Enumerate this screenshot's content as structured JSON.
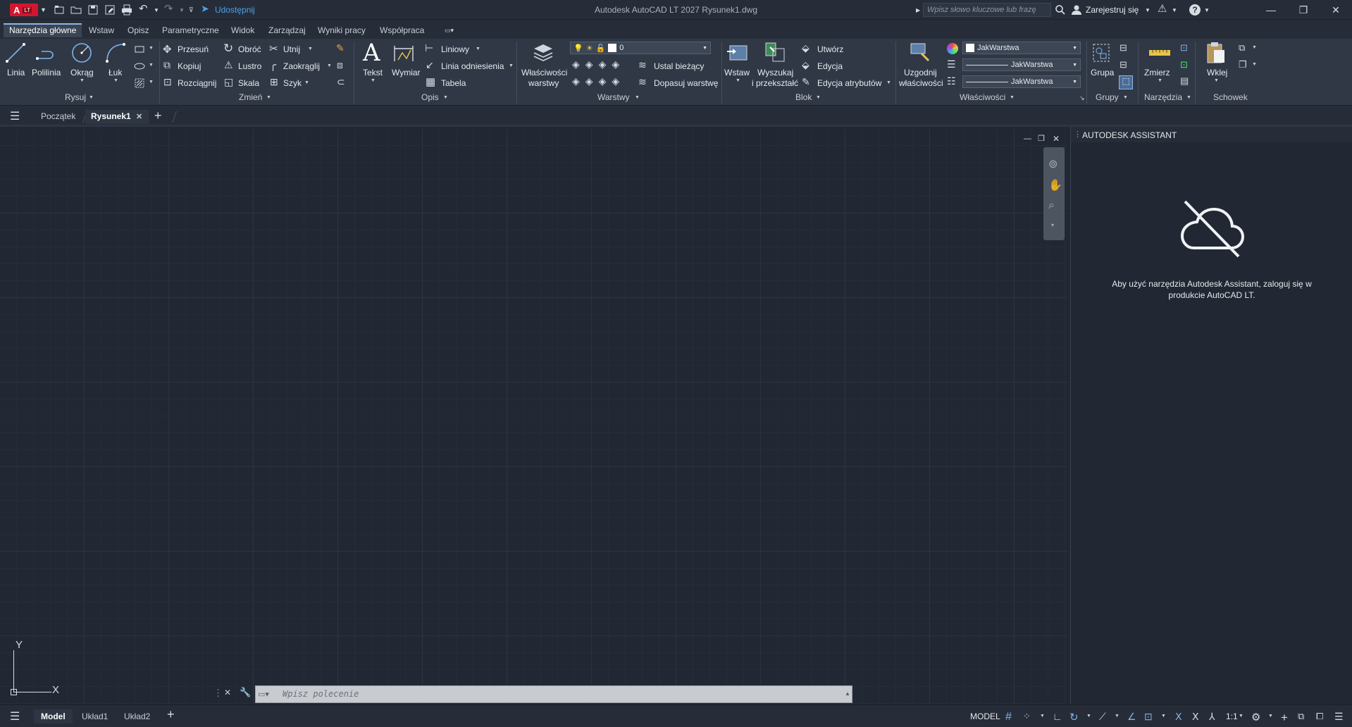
{
  "titlebar": {
    "app_badge": "A",
    "app_badge_lt": "LT",
    "share_label": "Udostępnij",
    "title": "Autodesk AutoCAD LT 2027    Rysunek1.dwg",
    "search_placeholder": "Wpisz słowo kluczowe lub frazę",
    "signin_label": "Zarejestruj się"
  },
  "tabs": [
    "Narzędzia główne",
    "Wstaw",
    "Opisz",
    "Parametryczne",
    "Widok",
    "Zarządzaj",
    "Wyniki pracy",
    "Współpraca"
  ],
  "ribbon": {
    "draw": {
      "title": "Rysuj",
      "linia": "Linia",
      "polilinia": "Polilinia",
      "okrag": "Okrąg",
      "luk": "Łuk"
    },
    "modify": {
      "title": "Zmień",
      "przesun": "Przesuń",
      "kopiuj": "Kopiuj",
      "rozciagnij": "Rozciągnij",
      "obroc": "Obróć",
      "lustro": "Lustro",
      "skala": "Skala",
      "utnij": "Utnij",
      "zaokraglij": "Zaokrąglij",
      "szyk": "Szyk"
    },
    "annotation": {
      "title": "Opis",
      "tekst": "Tekst",
      "wymiar": "Wymiar",
      "liniowy": "Liniowy",
      "linia_odniesienia": "Linia odniesienia",
      "tabela": "Tabela"
    },
    "layers": {
      "title": "Warstwy",
      "wlasciwosci_1": "Właściwości",
      "wlasciwosci_2": "warstwy",
      "layer_value": "0",
      "ustal": "Ustal bieżący",
      "dopasuj": "Dopasuj warstwę"
    },
    "block": {
      "title": "Blok",
      "wstaw": "Wstaw",
      "wyszukaj_1": "Wyszukaj",
      "wyszukaj_2": "i przekształć",
      "utworz": "Utwórz",
      "edycja": "Edycja",
      "edycja_atr": "Edycja atrybutów"
    },
    "properties": {
      "title": "Właściwości",
      "uzgodnij_1": "Uzgodnij",
      "uzgodnij_2": "właściwości",
      "color": "JakWarstwa",
      "lineweight": "JakWarstwa",
      "linetype": "JakWarstwa"
    },
    "groups": {
      "title": "Grupy",
      "grupa": "Grupa"
    },
    "utilities": {
      "title": "Narzędzia",
      "zmierz": "Zmierz"
    },
    "clipboard": {
      "title": "Schowek",
      "wklej": "Wklej"
    }
  },
  "filetabs": {
    "start": "Początek",
    "drawing": "Rysunek1"
  },
  "viewport": {
    "y_label": "Y",
    "x_label": "X"
  },
  "command": {
    "placeholder": "Wpisz polecenie"
  },
  "assistant": {
    "title": "AUTODESK ASSISTANT",
    "message": "Aby użyć narzędzia Autodesk Assistant, zaloguj się w produkcie AutoCAD LT."
  },
  "statusbar": {
    "tabs": [
      "Model",
      "Układ1",
      "Układ2"
    ],
    "model_label": "MODEL",
    "scale": "1:1"
  },
  "colors": {
    "accent": "#8fb4e8",
    "app_red": "#d3162f",
    "share_blue": "#4aa3e8"
  }
}
